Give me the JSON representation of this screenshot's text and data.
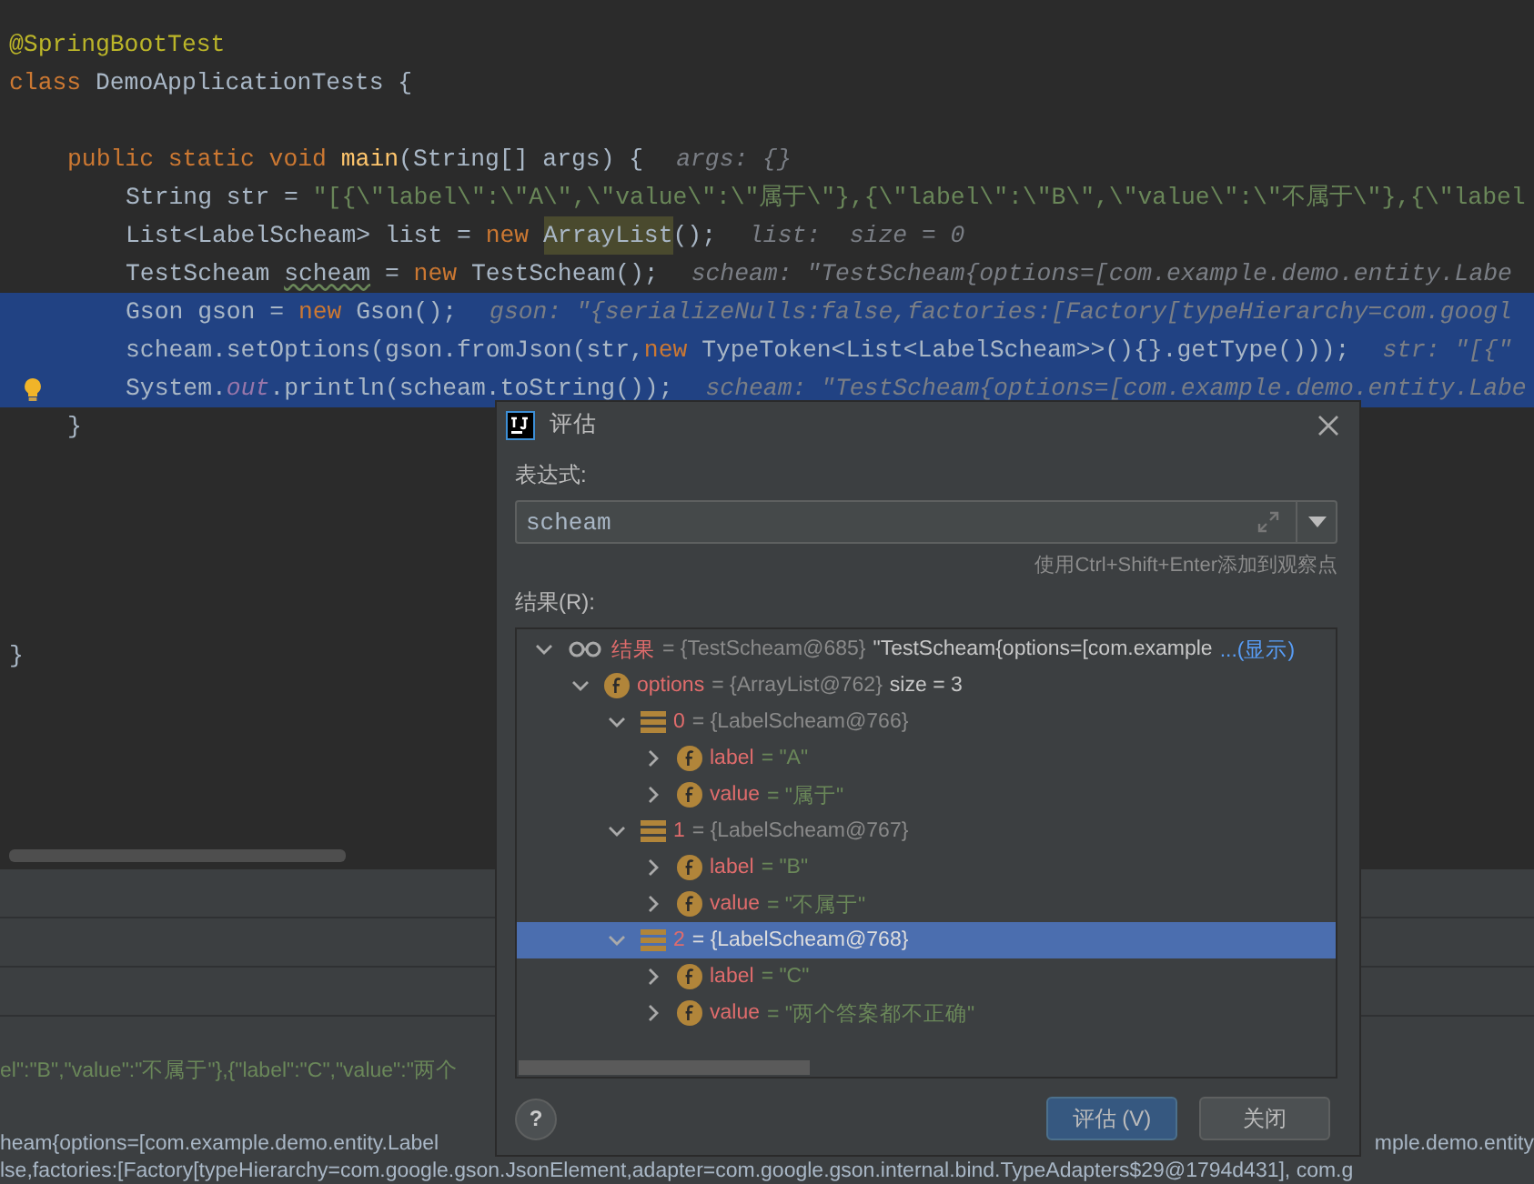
{
  "editor": {
    "lines": [
      {
        "tokens": [
          {
            "text": "@SpringBootTest",
            "kind": "annotation"
          }
        ]
      },
      {
        "tokens": [
          {
            "text": "class ",
            "kind": "keyword"
          },
          {
            "text": "DemoApplicationTests {",
            "kind": "plain"
          }
        ],
        "children": [
          {
            "tokens": [
              {
                "text": "public static void ",
                "kind": "keyword"
              },
              {
                "text": "main",
                "kind": "method"
              },
              {
                "text": "(String[] args) {",
                "kind": "plain"
              },
              {
                "text": "args: {}",
                "kind": "hint"
              }
            ],
            "children": [
              {
                "tokens": [
                  {
                    "text": "String str = ",
                    "kind": "plain"
                  },
                  {
                    "text": "\"[{\\\"label\\\":\\\"A\\\",\\\"value\\\":\\\"属于\\\"},{\\\"label\\\":\\\"B\\\",\\\"value\\\":\\\"不属于\\\"},{\\\"label",
                    "kind": "string"
                  }
                ]
              },
              {
                "tokens": [
                  {
                    "text": "List<LabelScheam> list = ",
                    "kind": "plain"
                  },
                  {
                    "text": "new ",
                    "kind": "keyword"
                  },
                  {
                    "text": "ArrayList",
                    "kind": "usage"
                  },
                  {
                    "text": "();",
                    "kind": "plain"
                  },
                  {
                    "text": "list:  size = 0",
                    "kind": "hint"
                  }
                ]
              },
              {
                "tokens": [
                  {
                    "text": "TestScheam ",
                    "kind": "plain"
                  },
                  {
                    "text": "scheam",
                    "kind": "typo"
                  },
                  {
                    "text": " = ",
                    "kind": "plain"
                  },
                  {
                    "text": "new ",
                    "kind": "keyword"
                  },
                  {
                    "text": "TestScheam();",
                    "kind": "plain"
                  },
                  {
                    "text": "scheam: \"TestScheam{options=[com.example.demo.entity.Labe",
                    "kind": "hint"
                  }
                ]
              },
              {
                "highlighted": true,
                "tokens": [
                  {
                    "text": "Gson gson = ",
                    "kind": "plain"
                  },
                  {
                    "text": "new ",
                    "kind": "keyword"
                  },
                  {
                    "text": "Gson();",
                    "kind": "plain"
                  },
                  {
                    "text": "gson: \"{serializeNulls:false,factories:[Factory[typeHierarchy=com.googl",
                    "kind": "hint"
                  }
                ]
              },
              {
                "highlighted": true,
                "tokens": [
                  {
                    "text": "scheam.setOptions(gson.fromJson(str,",
                    "kind": "plain"
                  },
                  {
                    "text": "new ",
                    "kind": "keyword"
                  },
                  {
                    "text": "TypeToken<List<LabelScheam>>(){}.getType()));",
                    "kind": "plain"
                  },
                  {
                    "text": "str: \"[{\"",
                    "kind": "hint"
                  }
                ]
              },
              {
                "highlighted": true,
                "bulb": true,
                "tokens": [
                  {
                    "text": "System.",
                    "kind": "plain"
                  },
                  {
                    "text": "out",
                    "kind": "static"
                  },
                  {
                    "text": ".println(scheam.toString());",
                    "kind": "plain"
                  },
                  {
                    "text": "scheam: \"TestScheam{options=[com.example.demo.entity.Labe",
                    "kind": "hint"
                  }
                ]
              }
            ]
          },
          {
            "tokens": [
              {
                "text": "}",
                "kind": "plain"
              }
            ]
          }
        ]
      },
      {
        "tokens": [
          {
            "text": "}",
            "kind": "plain"
          }
        ]
      }
    ]
  },
  "console": {
    "lines": [
      {
        "kind": "string",
        "left": "el\":\"B\",\"value\":\"不属于\"},{\"label\":\"C\",\"value\":\"两个"
      },
      {
        "kind": "plain",
        "left": "heam{options=[com.example.demo.entity.Label",
        "right": "mple.demo.entity"
      },
      {
        "kind": "plain",
        "left": "lse,factories:[Factory[typeHierarchy=com.google.gson.JsonElement,adapter=com.google.gson.internal.bind.TypeAdapters$29@1794d431], com.g"
      }
    ]
  },
  "dialog": {
    "title": "评估",
    "expression_label": "表达式:",
    "expression": "scheam",
    "hint": "使用Ctrl+Shift+Enter添加到观察点",
    "result_label": "结果(R):",
    "tree": [
      {
        "kind": "watch",
        "name": "结果",
        "ref": "= {TestScheam@685}",
        "value": "\"TestScheam{options=[com.example",
        "link": "...(显示)",
        "expanded": true,
        "selected": false,
        "children": [
          {
            "kind": "field",
            "name": "options",
            "ref": "= {ArrayList@762}",
            "value": "size = 3",
            "expanded": true,
            "selected": false,
            "children": [
              {
                "kind": "item",
                "name": "0",
                "ref": "= {LabelScheam@766}",
                "expanded": true,
                "selected": false,
                "children": [
                  {
                    "kind": "field",
                    "name": "label",
                    "value": "= \"A\"",
                    "expanded": false,
                    "selected": false
                  },
                  {
                    "kind": "field",
                    "name": "value",
                    "value": "= \"属于\"",
                    "expanded": false,
                    "selected": false
                  }
                ]
              },
              {
                "kind": "item",
                "name": "1",
                "ref": "= {LabelScheam@767}",
                "expanded": true,
                "selected": false,
                "children": [
                  {
                    "kind": "field",
                    "name": "label",
                    "value": "= \"B\"",
                    "expanded": false,
                    "selected": false
                  },
                  {
                    "kind": "field",
                    "name": "value",
                    "value": "= \"不属于\"",
                    "expanded": false,
                    "selected": false
                  }
                ]
              },
              {
                "kind": "item",
                "name": "2",
                "ref": "= {LabelScheam@768}",
                "expanded": true,
                "selected": true,
                "children": [
                  {
                    "kind": "field",
                    "name": "label",
                    "value": "= \"C\"",
                    "expanded": false,
                    "selected": false
                  },
                  {
                    "kind": "field",
                    "name": "value",
                    "value": "= \"两个答案都不正确\"",
                    "expanded": false,
                    "selected": false
                  }
                ]
              }
            ]
          }
        ]
      }
    ],
    "buttons": [
      {
        "label": "?",
        "kind": "help"
      },
      {
        "label": "评估 (V)",
        "kind": "primary"
      },
      {
        "label": "关闭",
        "kind": "normal"
      }
    ]
  }
}
